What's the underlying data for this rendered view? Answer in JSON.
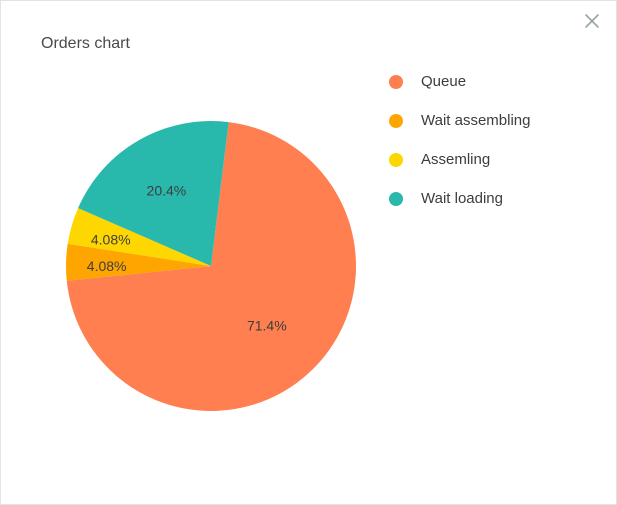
{
  "title": "Orders chart",
  "close_icon_name": "close-icon",
  "chart_data": {
    "type": "pie",
    "title": "Orders chart",
    "series": [
      {
        "name": "Queue",
        "value": 71.4,
        "label": "71.4%",
        "color": "#ff7f50"
      },
      {
        "name": "Wait assembling",
        "value": 4.08,
        "label": "4.08%",
        "color": "#ffa500"
      },
      {
        "name": "Assemling",
        "value": 4.08,
        "label": "4.08%",
        "color": "#ffd700"
      },
      {
        "name": "Wait loading",
        "value": 20.4,
        "label": "20.4%",
        "color": "#29b9ac"
      }
    ]
  }
}
